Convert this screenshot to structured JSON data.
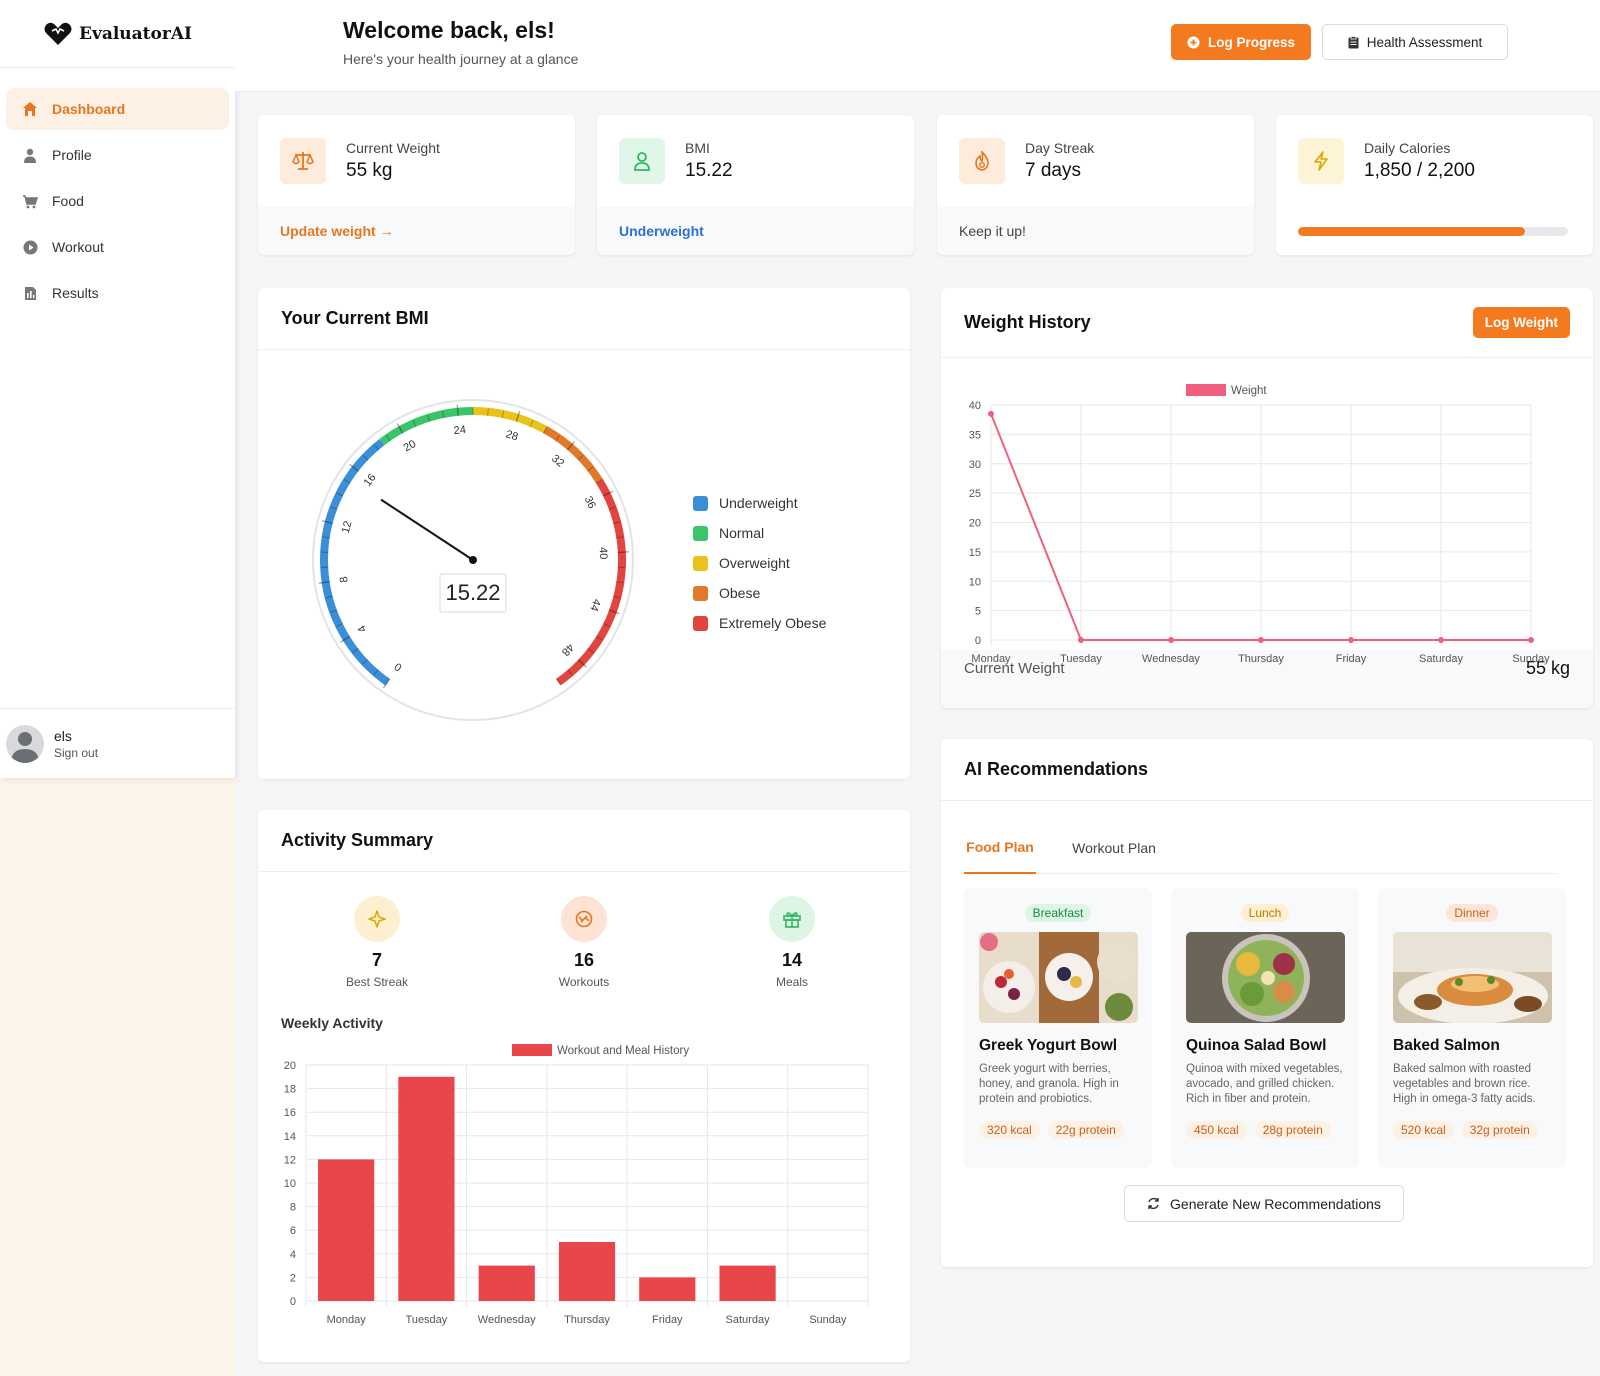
{
  "app": {
    "name": "EvaluatorAI"
  },
  "sidebar": {
    "items": [
      {
        "label": "Dashboard",
        "icon": "home-icon",
        "active": true
      },
      {
        "label": "Profile",
        "icon": "user-icon"
      },
      {
        "label": "Food",
        "icon": "cart-icon"
      },
      {
        "label": "Workout",
        "icon": "play-icon"
      },
      {
        "label": "Results",
        "icon": "document-icon"
      }
    ],
    "user": {
      "name": "els",
      "sign_out": "Sign out"
    }
  },
  "header": {
    "title": "Welcome back, els!",
    "subtitle": "Here's your health journey at a glance",
    "log_progress": "Log Progress",
    "health_assessment": "Health Assessment"
  },
  "stats": {
    "weight": {
      "label": "Current Weight",
      "value": "55 kg",
      "footer": "Update weight →"
    },
    "bmi": {
      "label": "BMI",
      "value": "15.22",
      "footer": "Underweight"
    },
    "streak": {
      "label": "Day Streak",
      "value": "7 days",
      "footer": "Keep it up!"
    },
    "calories": {
      "label": "Daily Calories",
      "value": "1,850 / 2,200",
      "progress": 0.84
    }
  },
  "bmi_card": {
    "title": "Your Current BMI",
    "value": "15.22",
    "gauge_min": 0,
    "gauge_max": 50,
    "tick_labels": [
      "0",
      "4",
      "8",
      "12",
      "16",
      "20",
      "24",
      "28",
      "32",
      "36",
      "40",
      "44",
      "48"
    ],
    "legend": [
      {
        "label": "Underweight",
        "color": "#3b8fd6"
      },
      {
        "label": "Normal",
        "color": "#3cc46a"
      },
      {
        "label": "Overweight",
        "color": "#e9c21b"
      },
      {
        "label": "Obese",
        "color": "#e07a2a"
      },
      {
        "label": "Extremely Obese",
        "color": "#e0463f"
      }
    ]
  },
  "weight_card": {
    "title": "Weight History",
    "button": "Log Weight",
    "footer_label": "Current Weight",
    "footer_value": "55 kg"
  },
  "activity": {
    "title": "Activity Summary",
    "items": [
      {
        "value": "7",
        "label": "Best Streak"
      },
      {
        "value": "16",
        "label": "Workouts"
      },
      {
        "value": "14",
        "label": "Meals"
      }
    ],
    "weekly_title": "Weekly Activity"
  },
  "recommendations": {
    "title": "AI Recommendations",
    "tabs": [
      "Food Plan",
      "Workout Plan"
    ],
    "meals": [
      {
        "tag": "Breakfast",
        "name": "Greek Yogurt Bowl",
        "desc": "Greek yogurt with berries, honey, and granola. High in protein and probiotics.",
        "kcal": "320 kcal",
        "protein": "22g protein"
      },
      {
        "tag": "Lunch",
        "name": "Quinoa Salad Bowl",
        "desc": "Quinoa with mixed vegetables, avocado, and grilled chicken. Rich in fiber and protein.",
        "kcal": "450 kcal",
        "protein": "28g protein"
      },
      {
        "tag": "Dinner",
        "name": "Baked Salmon",
        "desc": "Baked salmon with roasted vegetables and brown rice. High in omega-3 fatty acids.",
        "kcal": "520 kcal",
        "protein": "32g protein"
      }
    ],
    "generate": "Generate New Recommendations"
  },
  "chart_data": [
    {
      "type": "line",
      "legend": "Weight",
      "categories": [
        "Monday",
        "Tuesday",
        "Wednesday",
        "Thursday",
        "Friday",
        "Saturday",
        "Sunday"
      ],
      "series": [
        {
          "name": "Weight",
          "values": [
            38.5,
            0,
            0,
            0,
            0,
            0,
            0
          ]
        }
      ],
      "ylim": [
        0,
        40
      ],
      "yticks": [
        0,
        5,
        10,
        15,
        20,
        25,
        30,
        35,
        40
      ],
      "color": "#f0607e",
      "grid": true
    },
    {
      "type": "bar",
      "legend": "Workout and Meal History",
      "categories": [
        "Monday",
        "Tuesday",
        "Wednesday",
        "Thursday",
        "Friday",
        "Saturday",
        "Sunday"
      ],
      "series": [
        {
          "name": "Workout and Meal History",
          "values": [
            12,
            19,
            3,
            5,
            2,
            3,
            0
          ]
        }
      ],
      "ylim": [
        0,
        20
      ],
      "yticks": [
        0,
        2,
        4,
        6,
        8,
        10,
        12,
        14,
        16,
        18,
        20
      ],
      "color": "#e8464a",
      "grid": true
    }
  ]
}
